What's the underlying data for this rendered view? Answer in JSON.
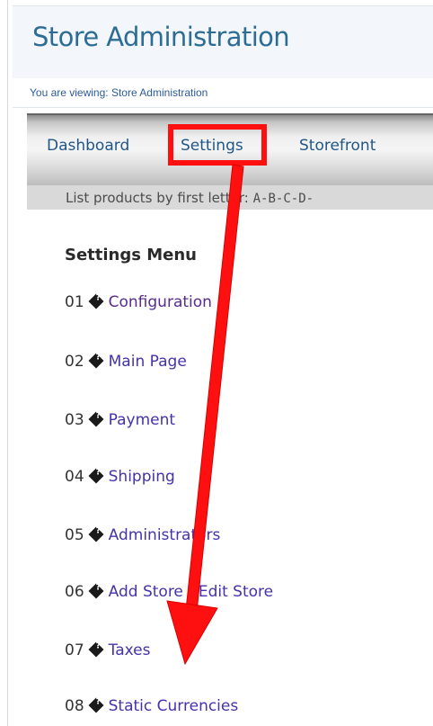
{
  "header": {
    "title": "Store Administration",
    "breadcrumb": "You are viewing: Store Administration"
  },
  "nav": {
    "tabs": [
      {
        "label": "Dashboard"
      },
      {
        "label": "Settings"
      },
      {
        "label": "Storefront"
      }
    ],
    "highlighted_tab": "Settings"
  },
  "subbar": {
    "prefix": "List products by first letter: ",
    "letters": "A-B-C-D-"
  },
  "menu": {
    "heading": "Settings Menu",
    "items": [
      {
        "num": "01",
        "label": "Configuration"
      },
      {
        "num": "02",
        "label": "Main Page"
      },
      {
        "num": "03",
        "label": "Payment"
      },
      {
        "num": "04",
        "label": "Shipping"
      },
      {
        "num": "05",
        "label": "Administrators"
      },
      {
        "num": "06",
        "label": "Add Store - Edit Store"
      },
      {
        "num": "07",
        "label": "Taxes"
      },
      {
        "num": "08",
        "label": "Static Currencies"
      }
    ]
  },
  "annotation": {
    "color": "#ff1010",
    "icon": "red-arrow-icon"
  }
}
